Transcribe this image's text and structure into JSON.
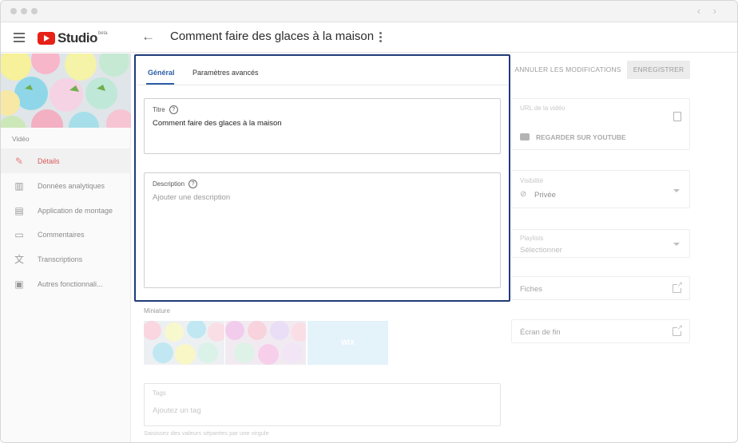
{
  "header": {
    "logo_text": "Studio",
    "logo_beta": "beta",
    "page_title": "Comment faire des glaces à la maison"
  },
  "sidebar": {
    "section_label": "Vidéo",
    "items": [
      {
        "label": "Détails",
        "icon": "pencil-icon",
        "glyph": "✎",
        "active": true
      },
      {
        "label": "Données analytiques",
        "icon": "analytics-icon",
        "glyph": "▥",
        "active": false
      },
      {
        "label": "Application de montage",
        "icon": "film-icon",
        "glyph": "▤",
        "active": false
      },
      {
        "label": "Commentaires",
        "icon": "comment-icon",
        "glyph": "▭",
        "active": false
      },
      {
        "label": "Transcriptions",
        "icon": "translate-icon",
        "glyph": "文",
        "active": false
      },
      {
        "label": "Autres fonctionnali...",
        "icon": "library-icon",
        "glyph": "▣",
        "active": false
      }
    ]
  },
  "tabs": [
    {
      "label": "Général",
      "active": true
    },
    {
      "label": "Paramètres avancés",
      "active": false
    }
  ],
  "form": {
    "title_label": "Titre",
    "title_value": "Comment faire des glaces à la maison",
    "description_label": "Description",
    "description_placeholder": "Ajouter une description",
    "thumbnail_label": "Miniature",
    "thumbnail_wix_text": "WIX",
    "tags_label": "Tags",
    "tags_placeholder": "Ajoutez un tag",
    "tags_hint": "Saisissez des valeurs séparées par une virgule"
  },
  "actions": {
    "cancel_label": "ANNULER LES MODIFICATIONS",
    "save_label": "ENREGISTRER"
  },
  "right_panel": {
    "video_url_label": "URL de la vidéo",
    "watch_label": "REGARDER SUR YOUTUBE",
    "visibility_label": "Visibilité",
    "visibility_value": "Privée",
    "playlists_label": "Playlists",
    "playlists_value": "Sélectionner",
    "cards_label": "Fiches",
    "end_screen_label": "Écran de fin"
  },
  "colors": {
    "accent": "#2b5ea7",
    "highlight_border": "#1f3b7a",
    "active_nav": "#d85a5a",
    "youtube_red": "#e62117"
  }
}
